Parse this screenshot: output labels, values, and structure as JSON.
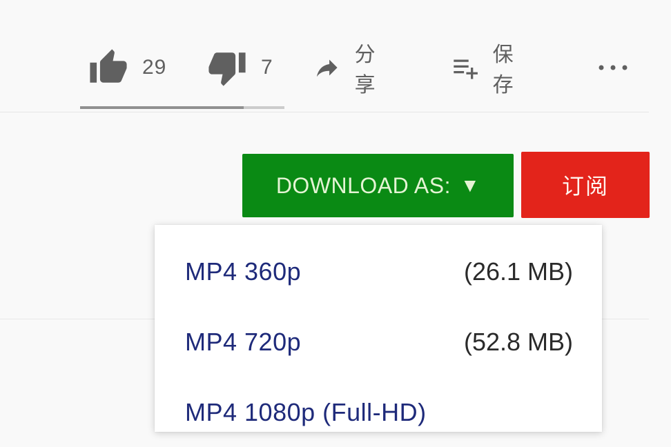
{
  "actions": {
    "like": {
      "label": "29"
    },
    "dislike": {
      "label": "7"
    },
    "share": {
      "label": "分享"
    },
    "save": {
      "label": "保存"
    },
    "more": {
      "icon": "more-horiz-icon"
    }
  },
  "sentiment": {
    "like_ratio": 0.8
  },
  "download_button": {
    "label": "DOWNLOAD AS:",
    "caret": "▼",
    "color": "#0a8a14"
  },
  "subscribe_button": {
    "label": "订阅",
    "color": "#e3241b"
  },
  "download_options": [
    {
      "format": "MP4 360p",
      "size": "(26.1 MB)"
    },
    {
      "format": "MP4 720p",
      "size": "(52.8 MB)"
    },
    {
      "format": "MP4 1080p (Full-HD)",
      "size": ""
    }
  ]
}
